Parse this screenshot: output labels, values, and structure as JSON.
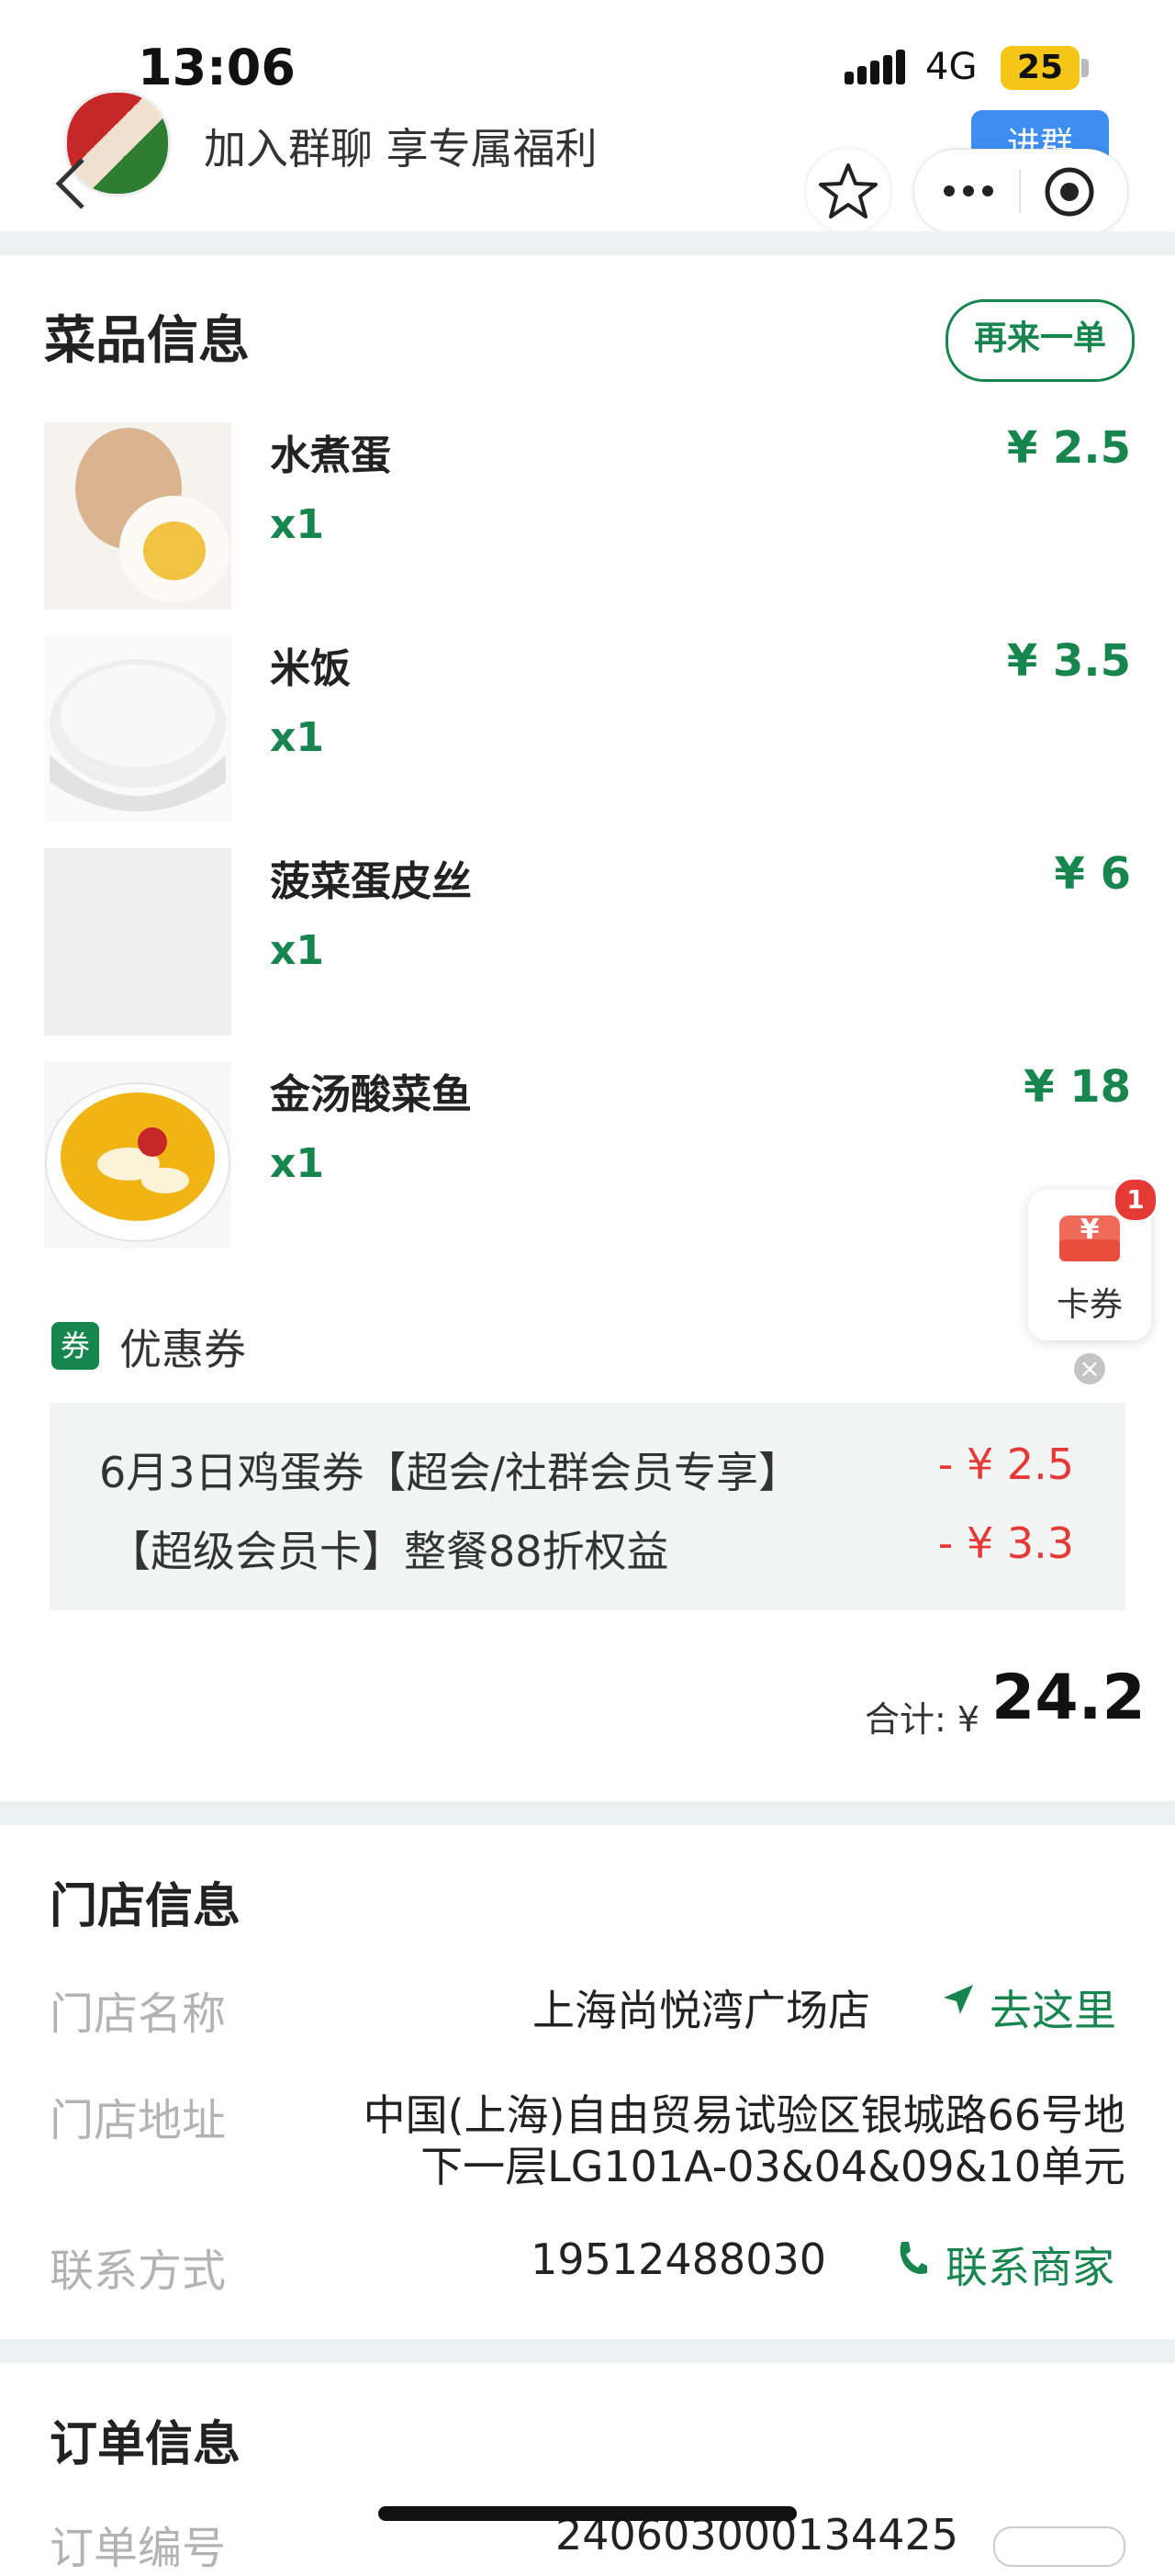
{
  "status_bar": {
    "time": "13:06",
    "network": "4G",
    "battery": "25"
  },
  "header": {
    "promo_text": "加入群聊 享专属福利",
    "join_label": "进群"
  },
  "dishes_section": {
    "title": "菜品信息",
    "reorder_label": "再来一单",
    "items": [
      {
        "name": "水煮蛋",
        "qty": "x1",
        "price": "¥ 2.5"
      },
      {
        "name": "米饭",
        "qty": "x1",
        "price": "¥ 3.5"
      },
      {
        "name": "菠菜蛋皮丝",
        "qty": "x1",
        "price": "¥ 6"
      },
      {
        "name": "金汤酸菜鱼",
        "qty": "x1",
        "price": "¥ 18"
      }
    ]
  },
  "floating_coupon": {
    "badge": "1",
    "label": "卡券",
    "icon": "¥"
  },
  "coupons": {
    "tag": "券",
    "title": "优惠券",
    "items": [
      {
        "name": "6月3日鸡蛋券【超会/社群会员专享】",
        "amount": "- ¥ 2.5"
      },
      {
        "name": "【超级会员卡】整餐88折权益",
        "amount": "- ¥ 3.3"
      }
    ]
  },
  "total": {
    "label": "合计: ¥",
    "value": "24.2"
  },
  "store_section": {
    "title": "门店信息",
    "name_label": "门店名称",
    "name_value": "上海尚悦湾广场店",
    "navigate_label": "去这里",
    "address_label": "门店地址",
    "address_line1": "中国(上海)自由贸易试验区银城路66号地",
    "address_line2": "下一层LG101A-03&04&09&10单元",
    "contact_label": "联系方式",
    "contact_value": "19512488030",
    "contact_action": "联系商家"
  },
  "order_section": {
    "title": "订单信息",
    "order_no_label": "订单编号",
    "order_no_value": "240603000134425"
  },
  "colors": {
    "accent": "#17854e",
    "discount": "#e53935",
    "join": "#3d8ef0",
    "band": "#ecf2f1"
  }
}
